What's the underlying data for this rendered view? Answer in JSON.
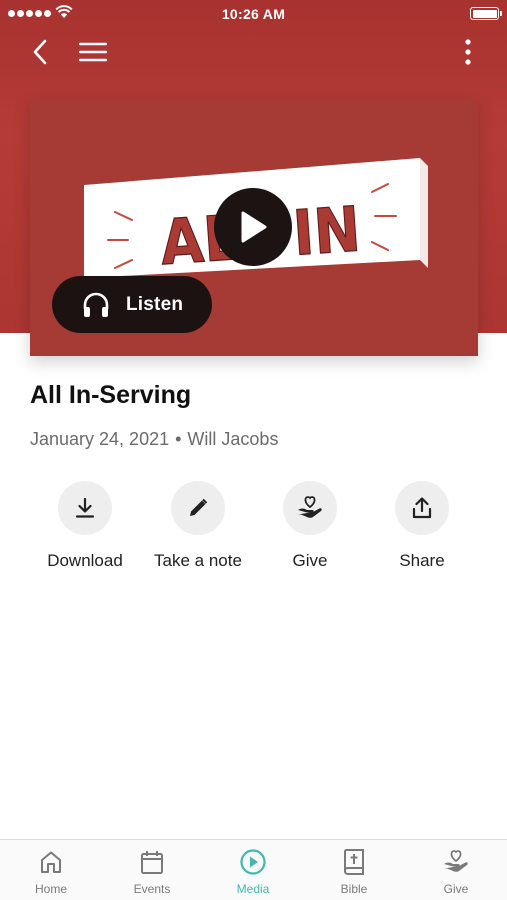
{
  "status_bar": {
    "time": "10:26 AM"
  },
  "header": {
    "back_icon": "chevron-left-icon",
    "menu_icon": "hamburger-icon",
    "more_icon": "more-vertical-icon"
  },
  "colors": {
    "hero": "#ad3632",
    "accent": "#3fb8b0",
    "dark_button": "#1c1211"
  },
  "media": {
    "artwork_text": "ALL IN",
    "play_icon": "play-icon",
    "listen_label": "Listen",
    "listen_icon": "headphones-icon"
  },
  "sermon": {
    "title": "All In-Serving",
    "date": "January 24, 2021",
    "separator": "•",
    "speaker": "Will Jacobs"
  },
  "actions": [
    {
      "label": "Download",
      "icon": "download-icon"
    },
    {
      "label": "Take a note",
      "icon": "pencil-icon"
    },
    {
      "label": "Give",
      "icon": "heart-hand-icon"
    },
    {
      "label": "Share",
      "icon": "share-icon"
    }
  ],
  "tabs": [
    {
      "label": "Home",
      "icon": "home-icon",
      "active": false
    },
    {
      "label": "Events",
      "icon": "calendar-icon",
      "active": false
    },
    {
      "label": "Media",
      "icon": "play-circle-icon",
      "active": true
    },
    {
      "label": "Bible",
      "icon": "bible-icon",
      "active": false
    },
    {
      "label": "Give",
      "icon": "heart-hand-icon",
      "active": false
    }
  ]
}
